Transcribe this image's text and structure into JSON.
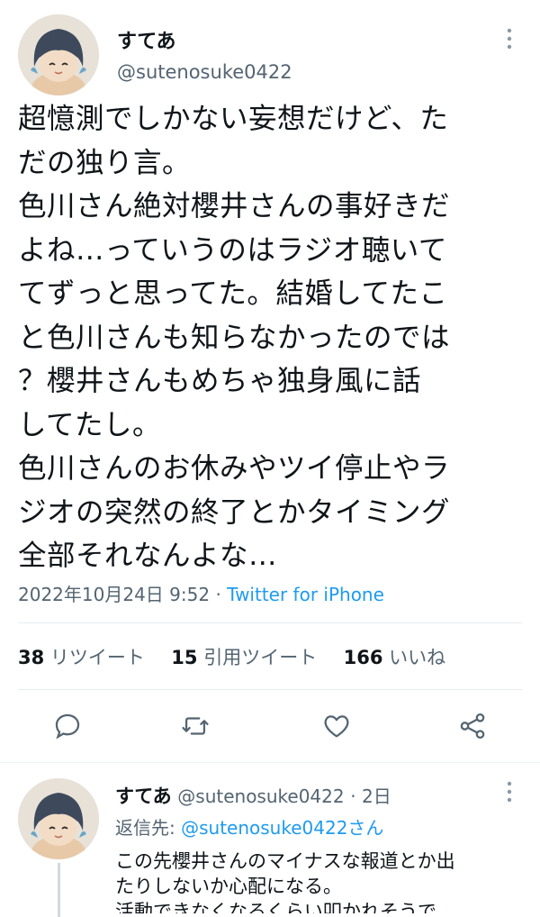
{
  "main_tweet": {
    "author_name": "すてあ",
    "author_handle": "@sutenosuke0422",
    "text_lines": [
      "超憶測でしかない妄想だけど、た",
      "だの独り言。",
      "色川さん絶対櫻井さんの事好きだ",
      "よね…っていうのはラジオ聴いて",
      "てずっと思ってた。結婚してたこ",
      "と色川さんも知らなかったのでは",
      "？櫻井さんもめちゃ独身風に話",
      "してたし。",
      "色川さんのお休みやツイ停止やラ",
      "ジオの突然の終了とかタイミング",
      "全部それなんよな…"
    ],
    "timestamp": "2022年10月24日 9:52",
    "separator": "·",
    "source": "Twitter for iPhone"
  },
  "stats": {
    "retweets_count": "38",
    "retweets_label": "リツイート",
    "quotes_count": "15",
    "quotes_label": "引用ツイート",
    "likes_count": "166",
    "likes_label": "いいね"
  },
  "actions": {
    "reply": "comment-icon",
    "retweet": "retweet-icon",
    "like": "heart-icon",
    "share": "share-icon"
  },
  "reply_tweet": {
    "author_name": "すてあ",
    "author_handle": "@sutenosuke0422",
    "time": "· 2日",
    "reply_to_prefix": "返信先:",
    "reply_to_handle": "@sutenosuke0422さん",
    "text_lines": [
      "この先櫻井さんのマイナスな報道とか出",
      "たりしないか心配になる。",
      "活動できなくなるくらい叩かれそうで"
    ]
  },
  "colors": {
    "link": "#1d9bf0",
    "secondary_text": "#536471",
    "primary_text": "#0f1419"
  }
}
